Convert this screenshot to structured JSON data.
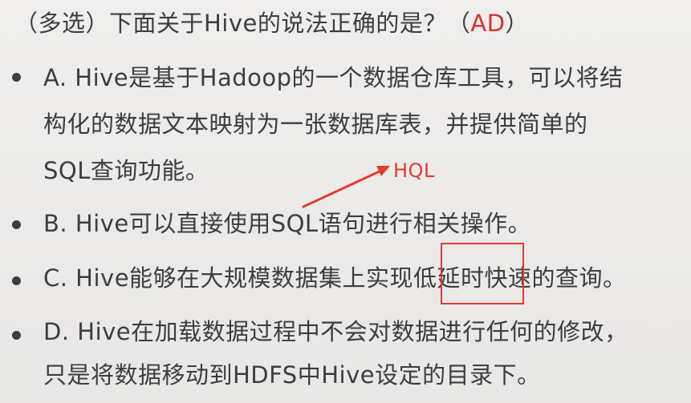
{
  "question": {
    "prefix": "（多选）下面关于Hive的说法正确的是？（",
    "answer": "AD",
    "suffix": "）"
  },
  "options": [
    {
      "lines": [
        "A. Hive是基于Hadoop的一个数据仓库工具，可以将结",
        "构化的数据文本映射为一张数据库表，并提供简单的",
        "SQL查询功能。"
      ]
    },
    {
      "lines": [
        "B. Hive可以直接使用SQL语句进行相关操作。"
      ]
    },
    {
      "lines": [
        "C. Hive能够在大规模数据集上实现低延时快速的查询。"
      ]
    },
    {
      "lines": [
        "D. Hive在加载数据过程中不会对数据进行任何的修改，",
        "只是将数据移动到HDFS中Hive设定的目录下。"
      ]
    }
  ],
  "annotation": {
    "note": "HQL"
  },
  "colors": {
    "text": "#3d3d40",
    "accent_red": "#e33b2e",
    "background": "#ecebe9"
  }
}
